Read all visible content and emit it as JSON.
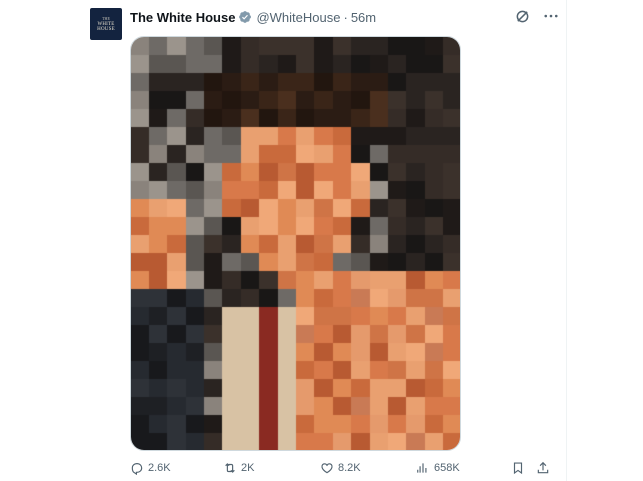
{
  "tweet": {
    "author": {
      "display_name": "The White House",
      "handle": "@WhiteHouse",
      "verified_color": "#829aab",
      "avatar_lines": [
        "THE",
        "WHITE",
        "HOUSE"
      ]
    },
    "separator": "·",
    "timestamp": "56m",
    "media": {
      "style": "pixelated-portrait"
    },
    "metrics": {
      "replies": "2.6K",
      "retweets": "2K",
      "likes": "8.2K",
      "views": "658K"
    },
    "icons": {
      "top": [
        "grok-icon",
        "more-icon"
      ],
      "actions": [
        "reply-icon",
        "retweet-icon",
        "like-icon",
        "views-icon",
        "bookmark-icon",
        "share-icon"
      ]
    }
  },
  "colors": {
    "text_primary": "#0f1419",
    "text_secondary": "#536471",
    "divider": "#eff3f4"
  }
}
